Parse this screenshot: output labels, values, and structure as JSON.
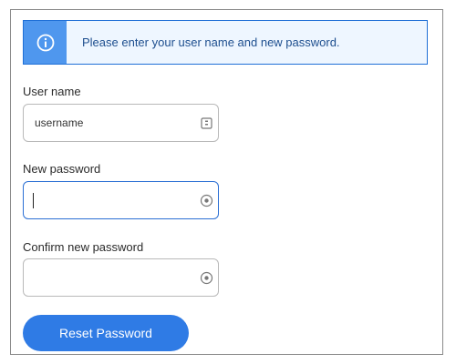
{
  "banner": {
    "icon": "info-icon",
    "message": "Please enter your user name and new password."
  },
  "username": {
    "label": "User name",
    "value": "",
    "placeholder": "username",
    "icon": "id-card-icon"
  },
  "new_password": {
    "label": "New password",
    "value": "",
    "icon": "eye-icon"
  },
  "confirm_password": {
    "label": "Confirm new password",
    "value": "",
    "icon": "eye-icon"
  },
  "reset_button": {
    "label": "Reset Password"
  },
  "colors": {
    "accent": "#2f7be5",
    "banner_bg": "#eef6ff",
    "banner_icon_bg": "#4f97ee"
  }
}
